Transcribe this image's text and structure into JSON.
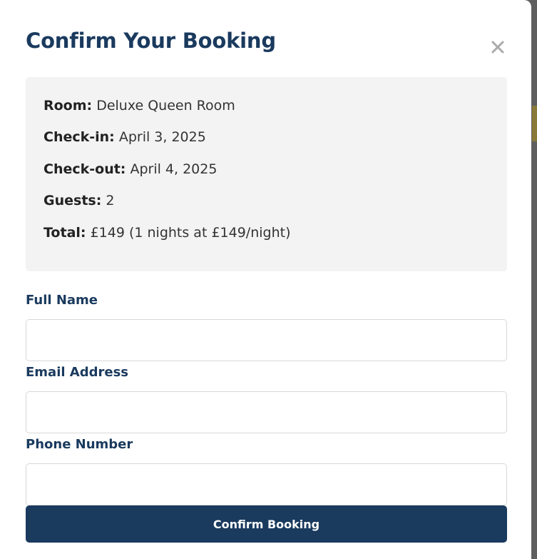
{
  "modal": {
    "title": "Confirm Your Booking",
    "close_icon": "close-icon"
  },
  "summary": {
    "room": {
      "label": "Room:",
      "value": "Deluxe Queen Room"
    },
    "check_in": {
      "label": "Check-in:",
      "value": "April 3, 2025"
    },
    "check_out": {
      "label": "Check-out:",
      "value": "April 4, 2025"
    },
    "guests": {
      "label": "Guests:",
      "value": "2"
    },
    "total": {
      "label": "Total:",
      "value": "£149 (1 nights at £149/night)"
    }
  },
  "form": {
    "full_name": {
      "label": "Full Name",
      "value": ""
    },
    "email": {
      "label": "Email Address",
      "value": ""
    },
    "phone": {
      "label": "Phone Number",
      "value": ""
    },
    "submit_label": "Confirm Booking"
  },
  "colors": {
    "primary": "#1a3a5e",
    "summary_bg": "#f3f3f3",
    "close_icon": "#aaaaaa"
  }
}
